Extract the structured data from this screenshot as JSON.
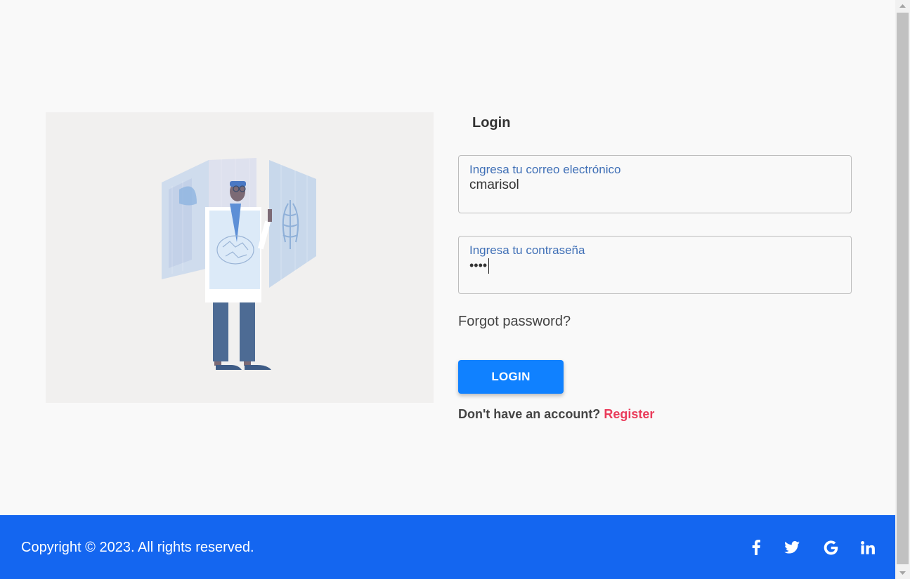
{
  "illustration": {
    "name": "doctor with medical scan panels illustration"
  },
  "form": {
    "title": "Login",
    "email": {
      "label": "Ingresa tu correo electrónico",
      "value": "cmarisol"
    },
    "password": {
      "label": "Ingresa tu contraseña",
      "value": "••••"
    },
    "forgot_label": "Forgot password?",
    "login_label": "LOGIN",
    "register_prompt": "Don't have an account?",
    "register_label": "Register"
  },
  "footer": {
    "copyright": "Copyright © 2023. All rights reserved.",
    "social_icons": [
      "facebook-icon",
      "twitter-icon",
      "google-icon",
      "linkedin-icon"
    ]
  },
  "colors": {
    "accent": "#1081ff",
    "footer": "#1466f0",
    "register": "#ea3b5a",
    "label": "#3f6fb6"
  }
}
